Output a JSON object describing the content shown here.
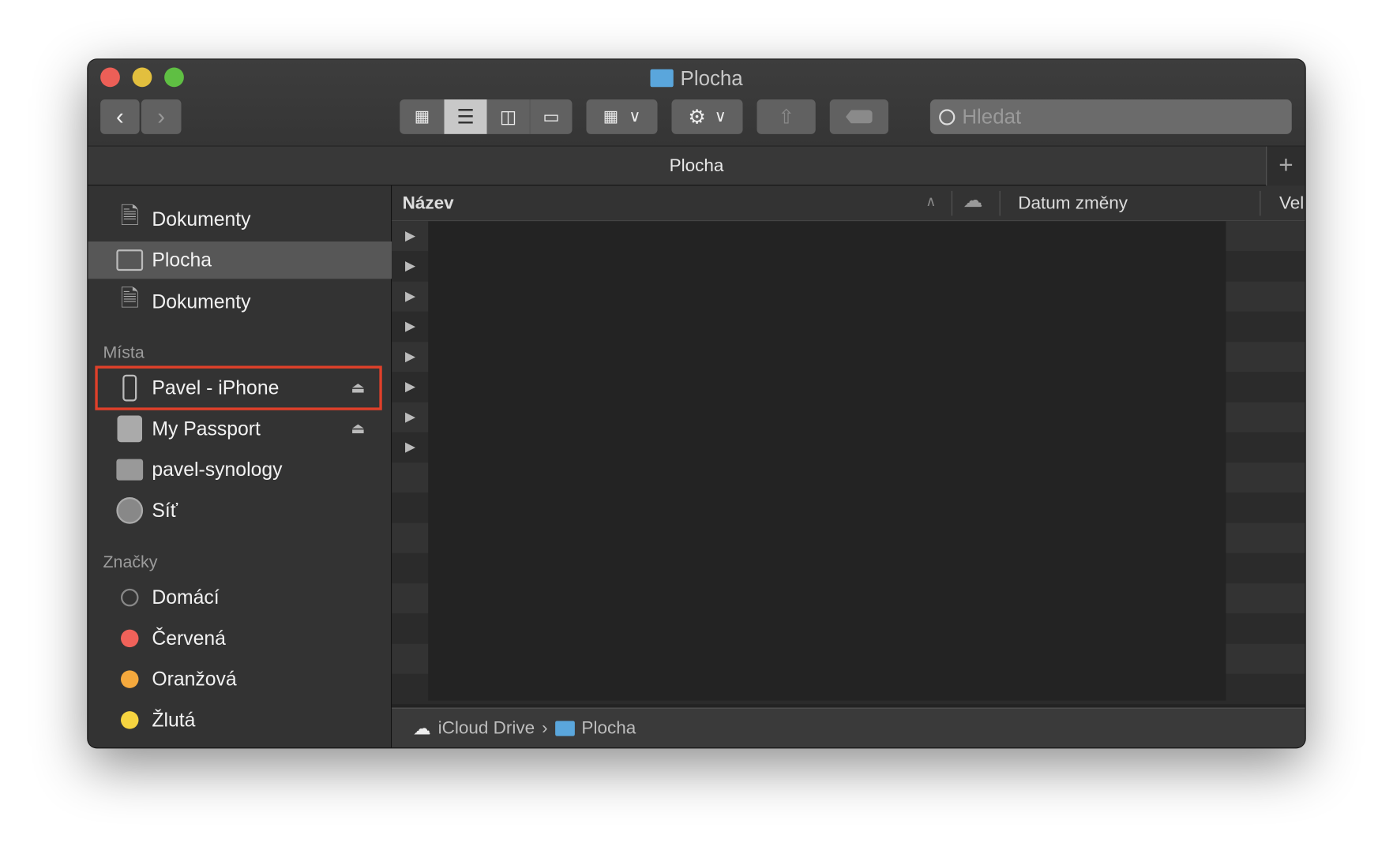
{
  "window": {
    "title": "Plocha"
  },
  "toolbar": {
    "back_icon": "chevron-left-icon",
    "forward_icon": "chevron-right-icon",
    "views": [
      "icon-view",
      "list-view",
      "column-view",
      "gallery-view"
    ],
    "search_placeholder": "Hledat"
  },
  "tab": {
    "label": "Plocha",
    "add_label": "+"
  },
  "sidebar": {
    "favorites": [
      {
        "label": "Dokumenty",
        "icon": "documents-icon"
      },
      {
        "label": "Plocha",
        "icon": "desktop-icon",
        "selected": true
      },
      {
        "label": "Dokumenty",
        "icon": "documents-icon"
      }
    ],
    "places_header": "Místa",
    "places": [
      {
        "label": "Pavel - iPhone",
        "icon": "iphone-icon",
        "eject": true,
        "highlighted": true
      },
      {
        "label": "My Passport",
        "icon": "external-drive-icon",
        "eject": true
      },
      {
        "label": "pavel-synology",
        "icon": "server-icon"
      },
      {
        "label": "Síť",
        "icon": "network-icon"
      }
    ],
    "tags_header": "Značky",
    "tags": [
      {
        "label": "Domácí",
        "color": "#3a3a3a"
      },
      {
        "label": "Červená",
        "color": "#f0625a"
      },
      {
        "label": "Oranžová",
        "color": "#f5a93d"
      },
      {
        "label": "Žlutá",
        "color": "#f6d440"
      }
    ]
  },
  "columns": {
    "name": "Název",
    "date": "Datum změny",
    "size": "Vel"
  },
  "path": {
    "root": "iCloud Drive",
    "separator": "›",
    "current": "Plocha"
  },
  "accent": {
    "highlight_box": "#e0402a",
    "folder": "#5aa6dc"
  }
}
